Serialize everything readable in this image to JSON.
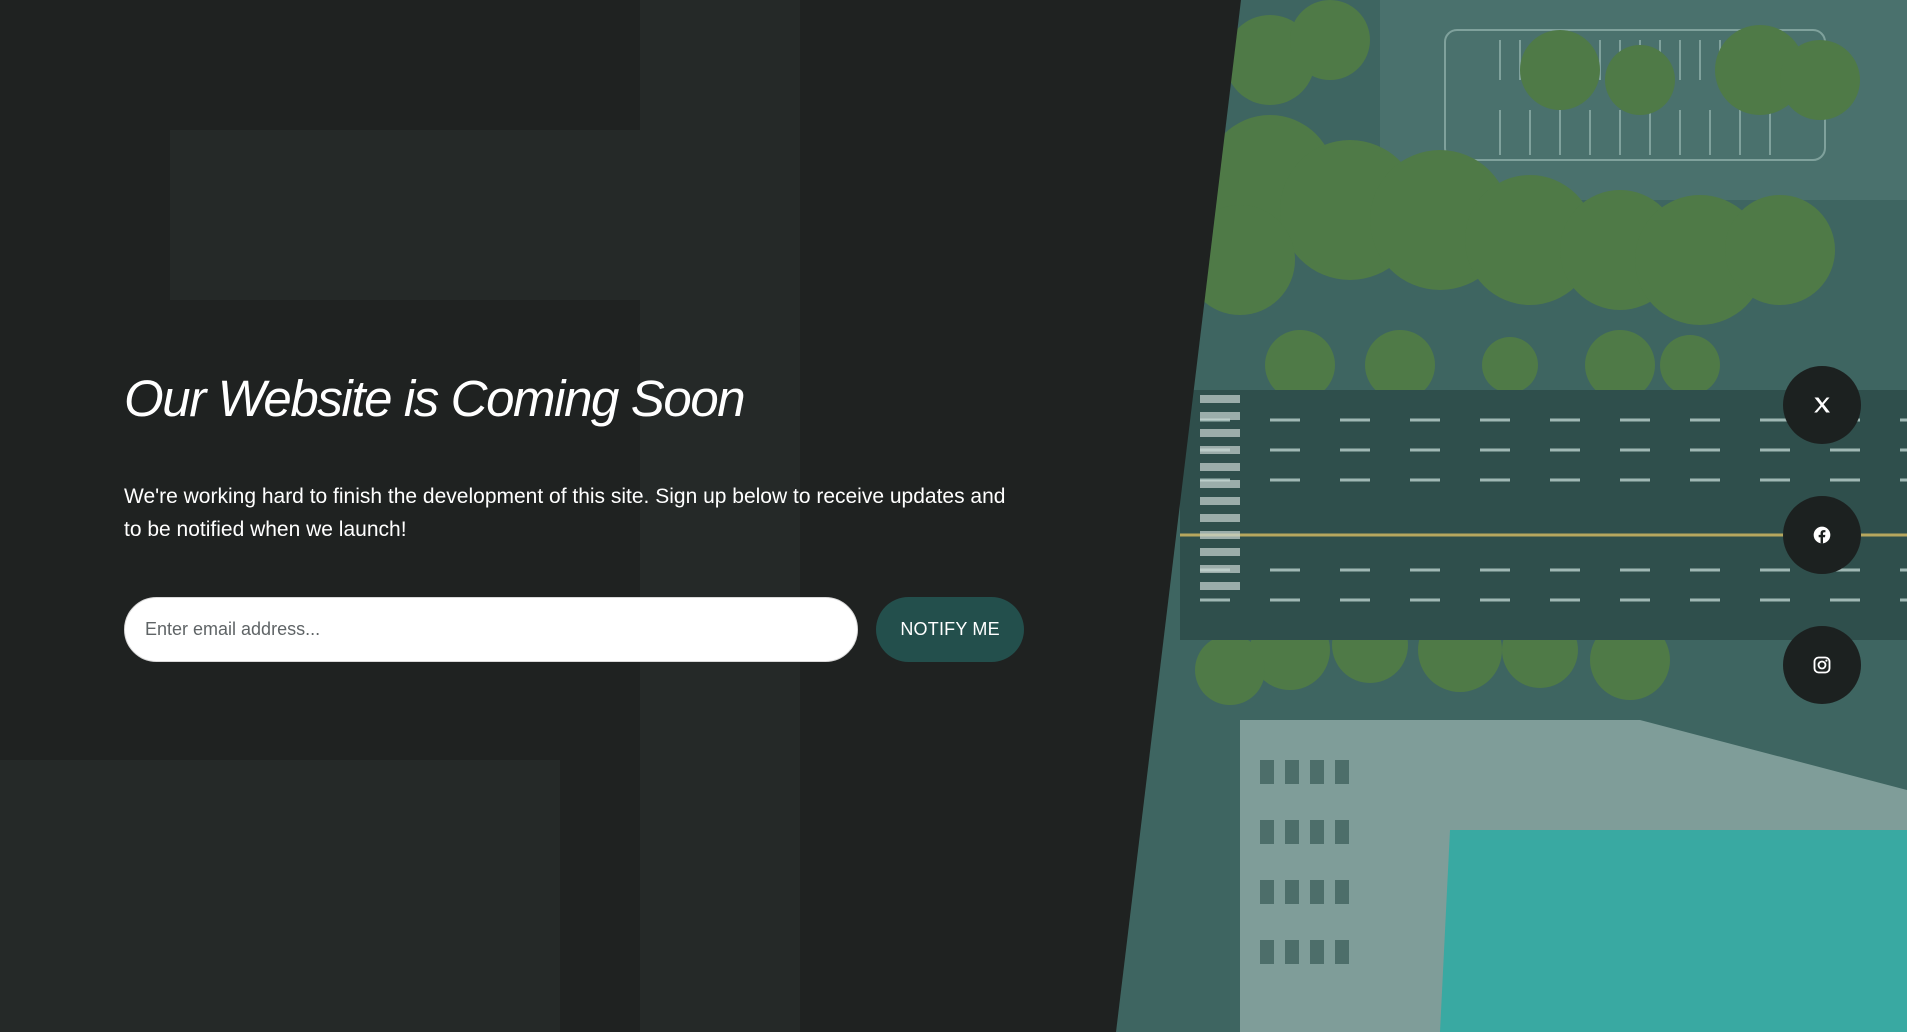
{
  "hero": {
    "title": "Our Website is Coming Soon",
    "description": "We're working hard to finish the development of this site. Sign up below to receive updates and to be notified when we launch!"
  },
  "signup": {
    "email_placeholder": "Enter email address...",
    "email_value": "",
    "button_label": "NOTIFY ME"
  },
  "social": [
    {
      "icon": "x-twitter-icon"
    },
    {
      "icon": "facebook-icon"
    },
    {
      "icon": "instagram-icon"
    }
  ],
  "colors": {
    "panel_dark": "#1f2221",
    "accent": "#234f4c",
    "photo_tint": "#3f6a66",
    "text": "#ffffff"
  }
}
